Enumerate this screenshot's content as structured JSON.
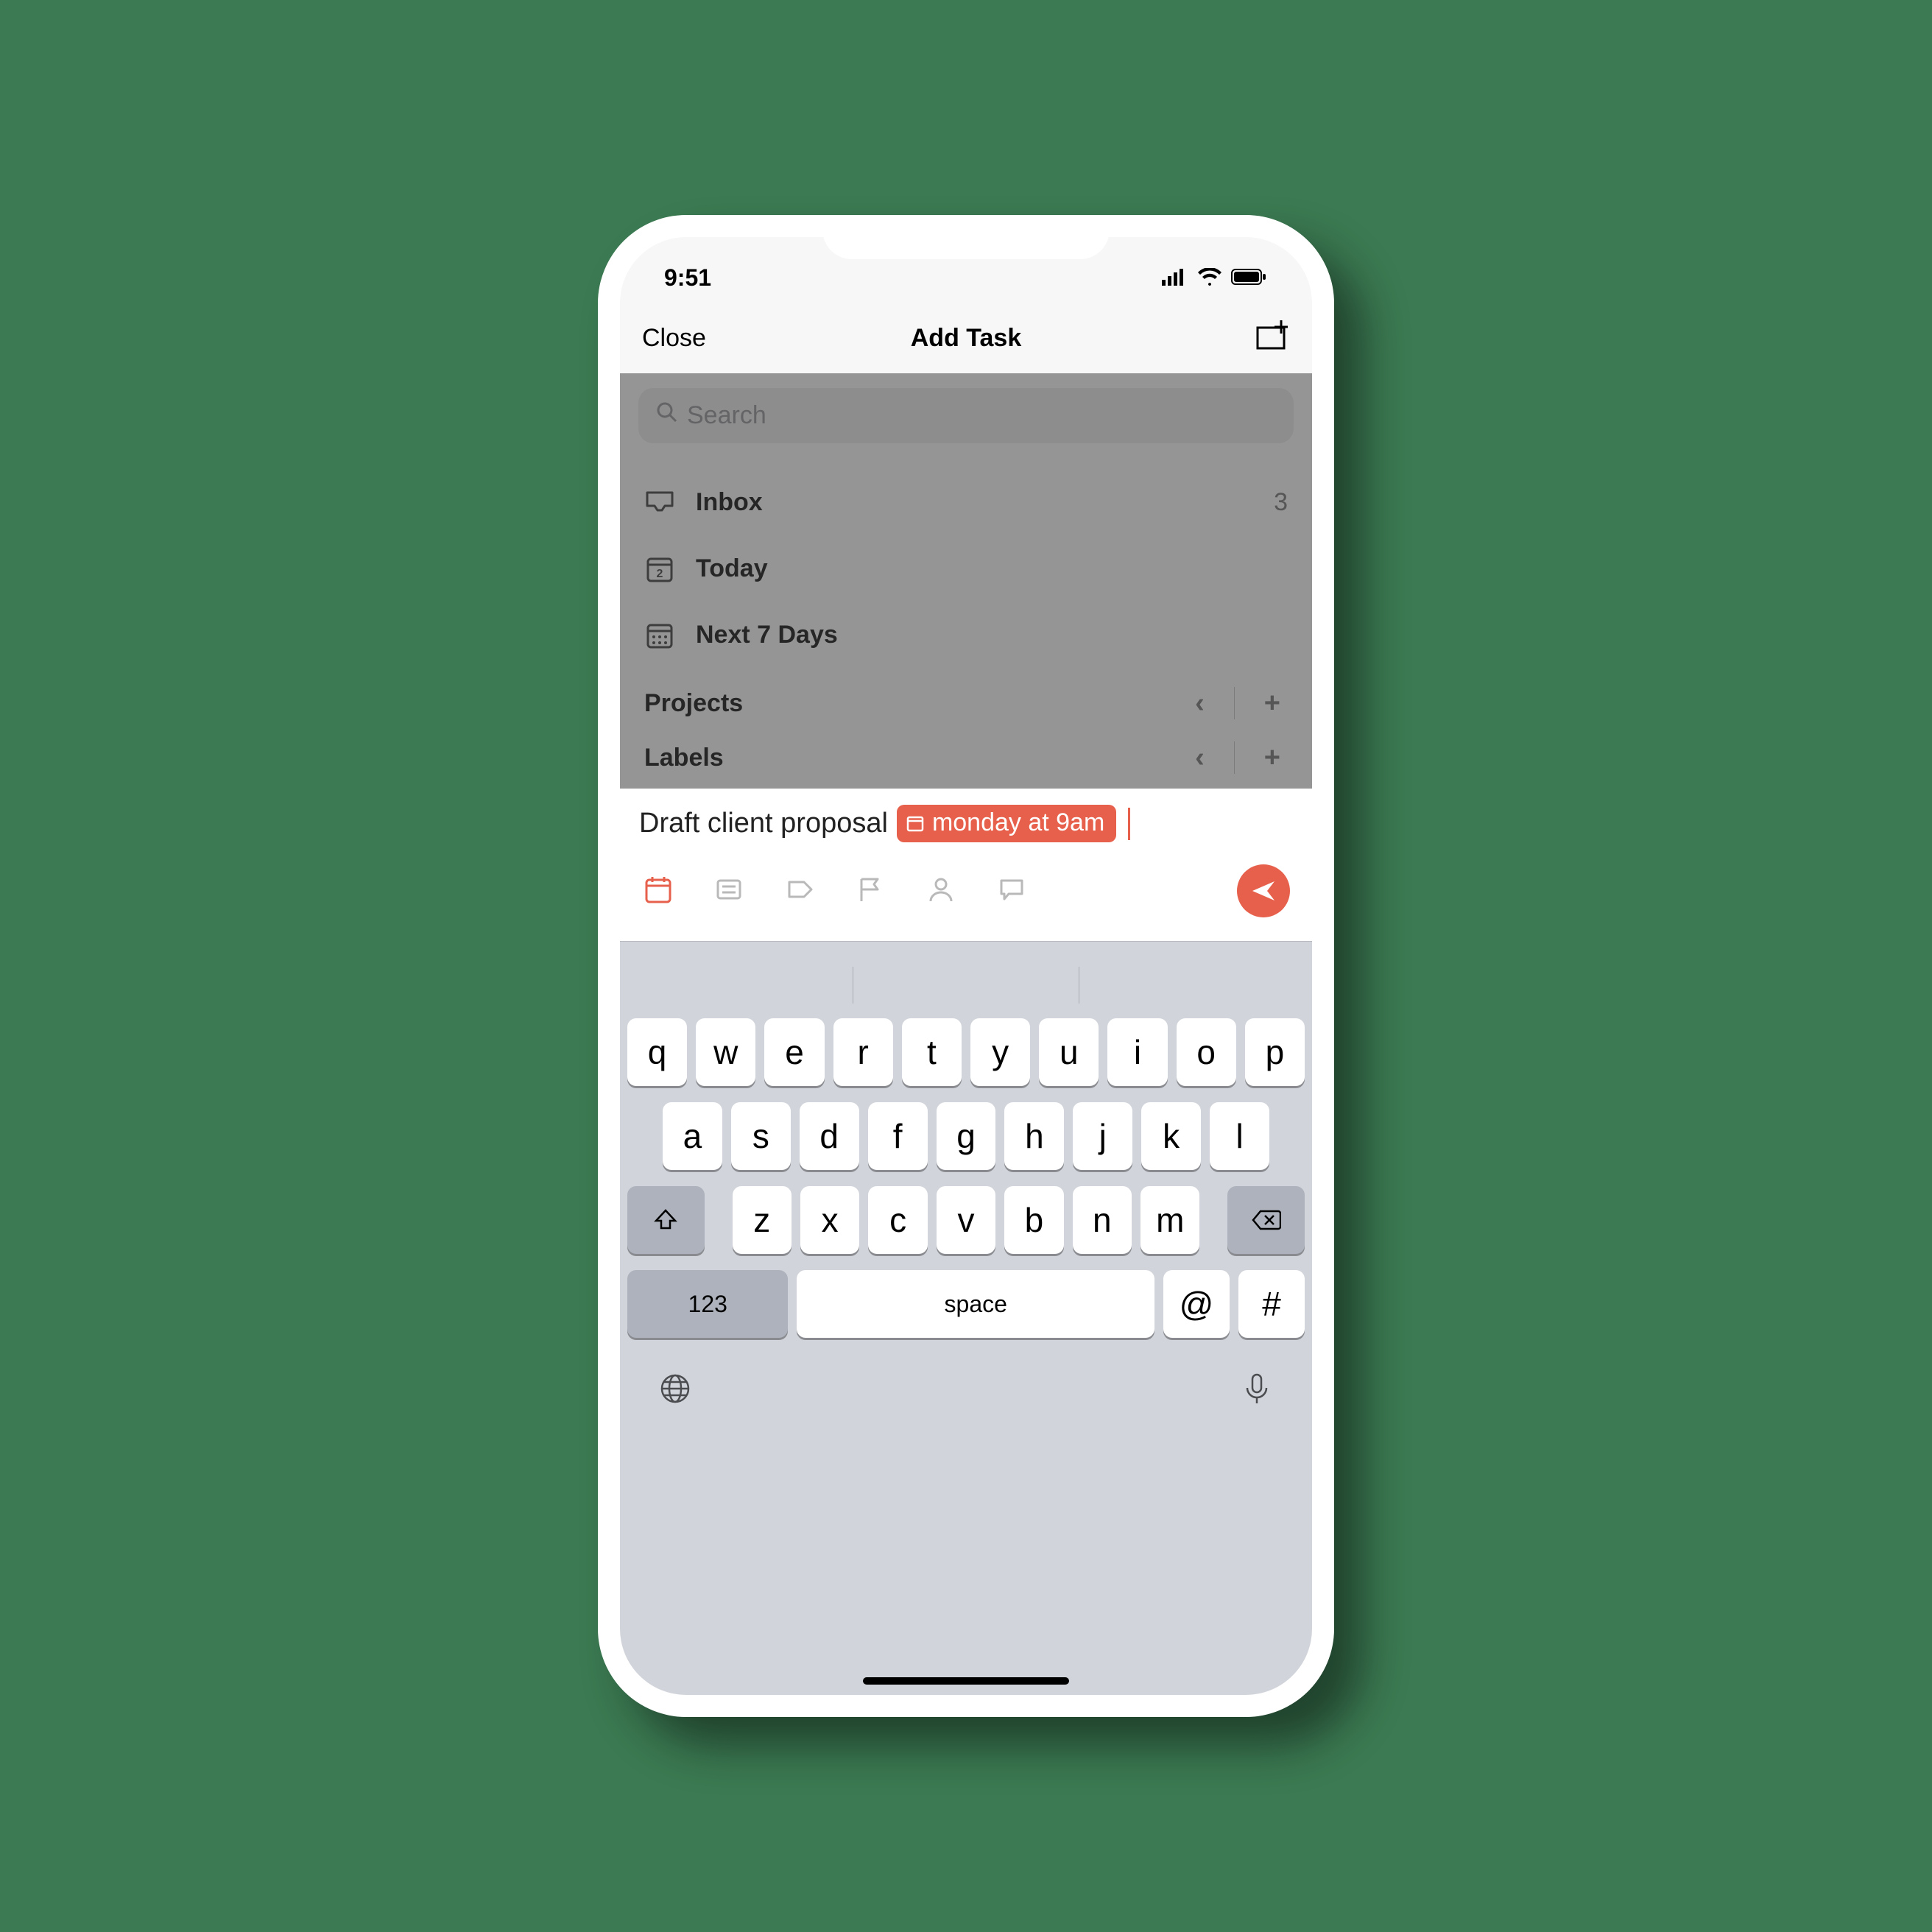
{
  "status": {
    "time": "9:51"
  },
  "nav": {
    "close": "Close",
    "title": "Add Task"
  },
  "search": {
    "placeholder": "Search"
  },
  "menu": {
    "inbox": {
      "label": "Inbox",
      "count": "3"
    },
    "today": {
      "label": "Today",
      "today_num": "2"
    },
    "next7": {
      "label": "Next 7 Days"
    }
  },
  "sections": {
    "projects": "Projects",
    "labels": "Labels"
  },
  "task": {
    "text": "Draft client proposal",
    "chip": "monday at 9am"
  },
  "keyboard": {
    "row1": [
      "q",
      "w",
      "e",
      "r",
      "t",
      "y",
      "u",
      "i",
      "o",
      "p"
    ],
    "row2": [
      "a",
      "s",
      "d",
      "f",
      "g",
      "h",
      "j",
      "k",
      "l"
    ],
    "row3": [
      "z",
      "x",
      "c",
      "v",
      "b",
      "n",
      "m"
    ],
    "numbers": "123",
    "space": "space",
    "at": "@",
    "hash": "#"
  }
}
